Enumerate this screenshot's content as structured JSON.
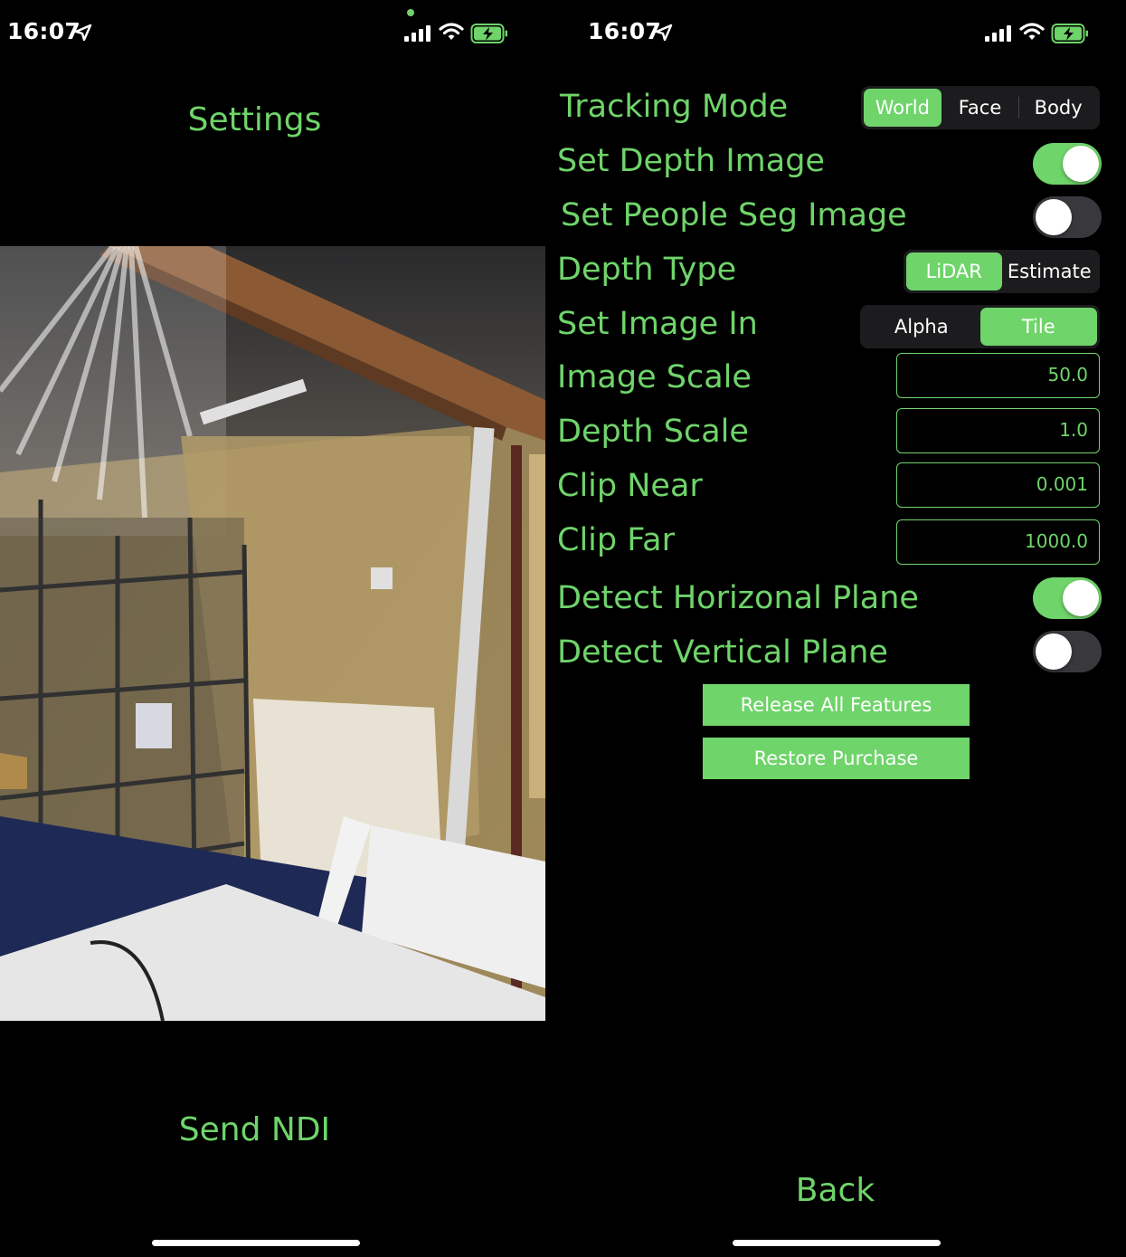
{
  "left_screen": {
    "status_bar": {
      "time": "16:07"
    },
    "title": "Settings",
    "bottom_action": "Send NDI"
  },
  "right_screen": {
    "status_bar": {
      "time": "16:07"
    },
    "tracking_mode": {
      "label": "Tracking Mode",
      "options": [
        "World",
        "Face",
        "Body"
      ],
      "selected": "World"
    },
    "set_depth_image": {
      "label": "Set Depth Image",
      "on": true
    },
    "set_people_seg_image": {
      "label": "Set People Seg Image",
      "on": false
    },
    "depth_type": {
      "label": "Depth Type",
      "options": [
        "LiDAR",
        "Estimate"
      ],
      "selected": "LiDAR"
    },
    "set_image_in": {
      "label": "Set Image In",
      "options": [
        "Alpha",
        "Tile"
      ],
      "selected": "Tile"
    },
    "image_scale": {
      "label": "Image Scale",
      "value": "50.0"
    },
    "depth_scale": {
      "label": "Depth Scale",
      "value": "1.0"
    },
    "clip_near": {
      "label": "Clip Near",
      "value": "0.001"
    },
    "clip_far": {
      "label": "Clip Far",
      "value": "1000.0"
    },
    "detect_horizontal_plane": {
      "label": "Detect Horizonal Plane",
      "on": true
    },
    "detect_vertical_plane": {
      "label": "Detect Vertical Plane",
      "on": false
    },
    "release_button": "Release All Features",
    "restore_button": "Restore Purchase",
    "back": "Back"
  },
  "colors": {
    "accent": "#6fd46a",
    "background": "#000000",
    "segment_bg": "#1c1c1e",
    "toggle_off": "#39393d"
  },
  "icons": [
    "location-arrow-icon",
    "cellular-signal-icon",
    "wifi-icon",
    "battery-charging-icon"
  ]
}
